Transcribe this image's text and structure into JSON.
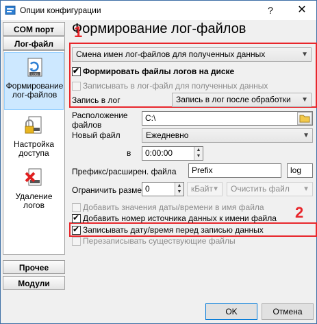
{
  "window": {
    "title": "Опции конфигурации",
    "help_glyph": "?",
    "close_glyph": "✕"
  },
  "left": {
    "btn_com": "COM порт",
    "btn_log": "Лог-файл",
    "items": [
      {
        "label": "Формирование лог-файлов"
      },
      {
        "label": "Настройка доступа"
      },
      {
        "label": "Удаление логов"
      }
    ],
    "btn_other": "Прочее",
    "btn_modules": "Модули"
  },
  "main": {
    "heading": "Формирование лог-файлов",
    "marker1": "1",
    "marker2": "2",
    "rename_combo": "Смена имен лог-файлов для полученных данных",
    "chk_make_logs": "Формировать файлы логов на диске",
    "chk_write_received": "Записывать в лог-файл для полученных данных",
    "write_to_log_label": "Запись в лог",
    "write_to_log_value": "Запись в лог после обработки",
    "location_label": "Расположение файлов",
    "location_value": "C:\\",
    "new_file_label": "Новый файл",
    "new_file_value": "Ежедневно",
    "at_label": "в",
    "time_value": "0:00:00",
    "prefix_label": "Префикс/расширен. файла",
    "prefix_value": "Prefix",
    "ext_value": "log",
    "limit_label": "Ограничить размер",
    "limit_value": "0",
    "unit_value": "кБайт",
    "clear_value": "Очистить файл",
    "chk_add_datetime": "Добавить значения даты/времени в имя файла",
    "chk_add_source": "Добавить номер источника данных к имени файла",
    "chk_write_datetime": "Записывать дату/время перед записью данных",
    "chk_overwrite": "Перезаписывать существующие файлы"
  },
  "buttons": {
    "ok": "OK",
    "cancel": "Отмена"
  },
  "colors": {
    "highlight": "#e8262b",
    "selection": "#cde8ff"
  }
}
